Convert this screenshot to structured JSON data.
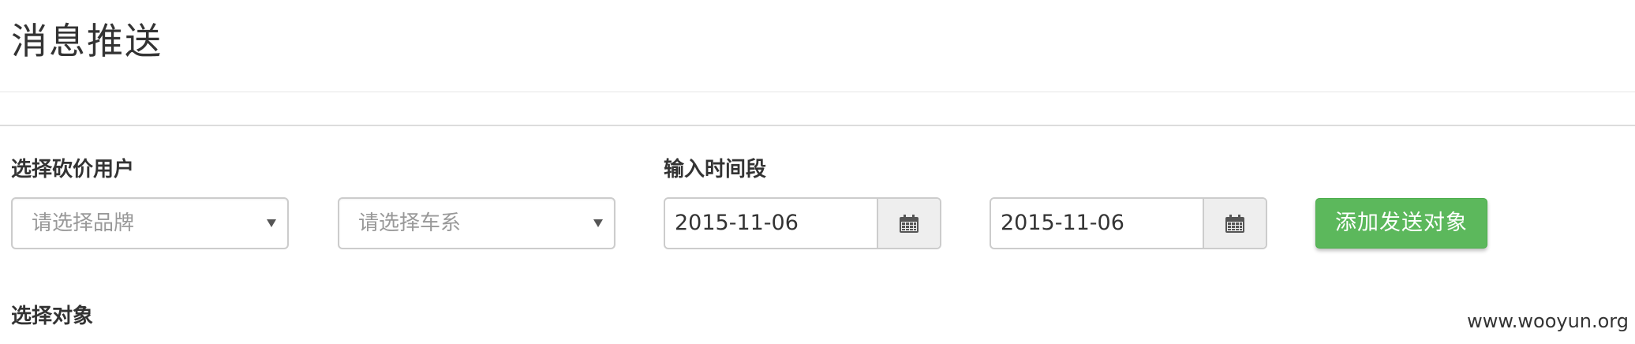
{
  "page": {
    "title": "消息推送"
  },
  "filters": {
    "user_label": "选择砍价用户",
    "brand_placeholder": "请选择品牌",
    "series_placeholder": "请选择车系",
    "time_label": "输入时间段",
    "start_date": "2015-11-06",
    "end_date": "2015-11-06",
    "add_button": "添加发送对象",
    "calendar_icon": "calendar-icon"
  },
  "targets": {
    "label": "选择对象"
  },
  "watermark": "www.wooyun.org",
  "colors": {
    "accent_green": "#5cb85c",
    "border": "#cccccc",
    "addon_bg": "#eeeeee",
    "placeholder_text": "#999999"
  }
}
